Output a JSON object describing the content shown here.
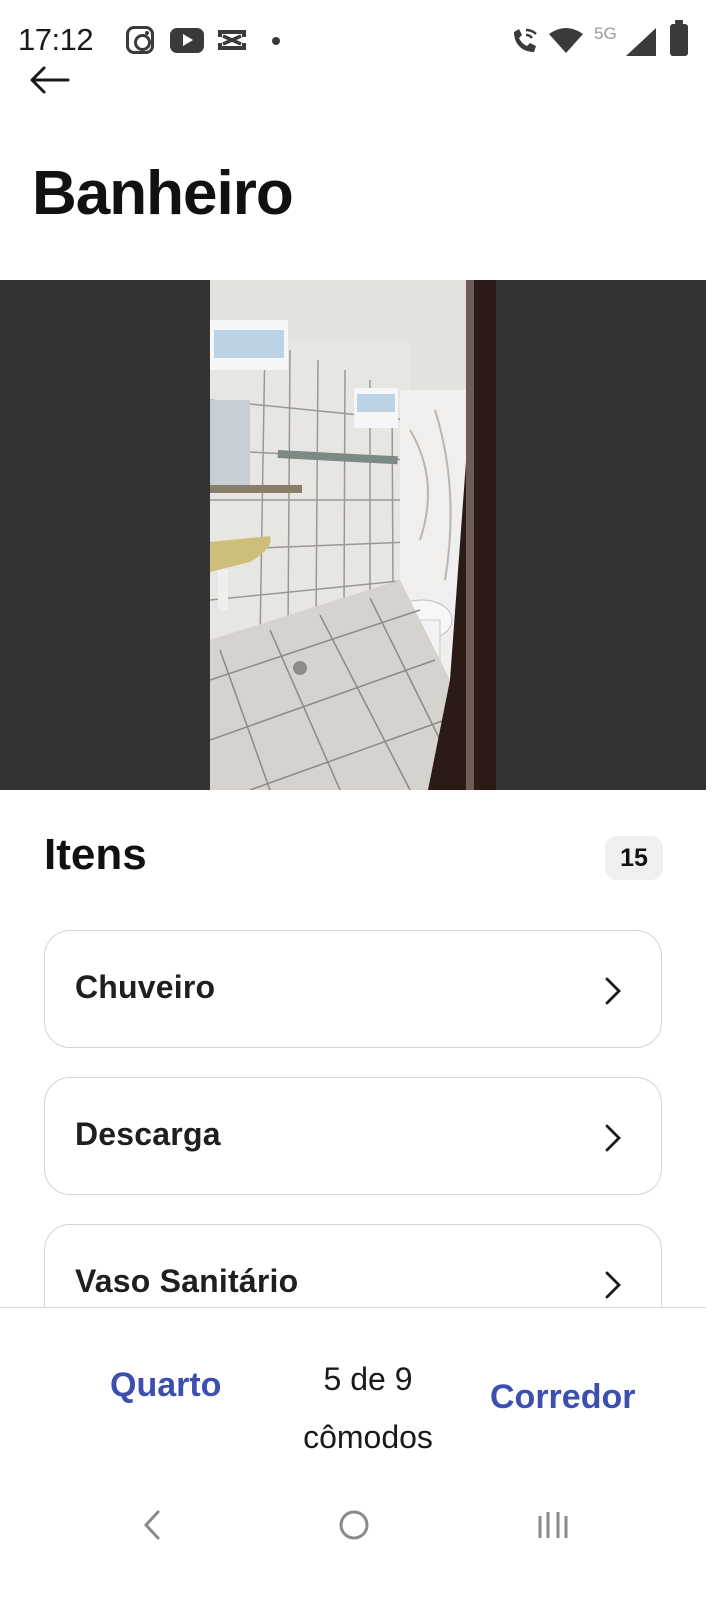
{
  "status_bar": {
    "time": "17:12",
    "network": "5G",
    "icons": [
      "instagram-icon",
      "youtube-icon",
      "capcut-icon",
      "notification-dot-icon",
      "wifi-call-icon",
      "wifi-icon",
      "signal-icon",
      "battery-icon"
    ]
  },
  "header": {
    "back_icon": "arrow-left-icon",
    "title": "Banheiro"
  },
  "photo": {
    "subject": "room-photo"
  },
  "items_section": {
    "title": "Itens",
    "count": "15",
    "items": [
      {
        "label": "Chuveiro"
      },
      {
        "label": "Descarga"
      },
      {
        "label": "Vaso Sanitário"
      }
    ]
  },
  "room_nav": {
    "prev_label": "Quarto",
    "progress_line1": "5 de 9",
    "progress_line2": "cômodos",
    "next_label": "Corredor",
    "accent_color": "#3c4fb0"
  },
  "system_nav": {
    "icons": [
      "back-icon",
      "home-icon",
      "recents-icon"
    ]
  }
}
